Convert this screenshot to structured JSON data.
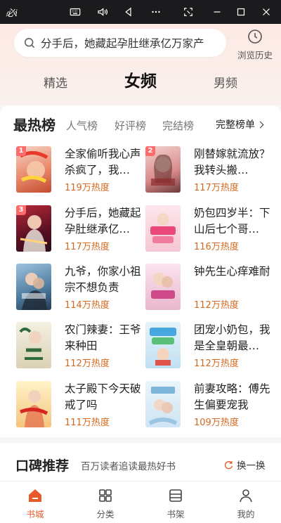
{
  "window": {
    "title": "必i"
  },
  "header": {
    "search": {
      "text": "分手后，她藏起孕肚继承亿万家产"
    },
    "history_label": "浏览历史",
    "tabs": [
      {
        "label": "精选"
      },
      {
        "label": "女频"
      },
      {
        "label": "男频"
      }
    ]
  },
  "ranking": {
    "tabs": [
      {
        "label": "最热榜"
      },
      {
        "label": "人气榜"
      },
      {
        "label": "好评榜"
      },
      {
        "label": "完结榜"
      }
    ],
    "full_list_label": "完整榜单",
    "books": [
      {
        "rank": "1",
        "title": "全家偷听我心声杀疯了，我…",
        "heat": "119万热度"
      },
      {
        "rank": "2",
        "title": "刚替嫁就流放？我转头搬…",
        "heat": "117万热度"
      },
      {
        "rank": "3",
        "title": "分手后，她藏起孕肚继承亿…",
        "heat": "117万热度"
      },
      {
        "rank": "",
        "title": "奶包四岁半：下山后七个哥…",
        "heat": "116万热度"
      },
      {
        "rank": "",
        "title": "九爷，你家小祖宗不想负责",
        "heat": "114万热度"
      },
      {
        "rank": "",
        "title": "钟先生心痒难耐",
        "heat": "112万热度"
      },
      {
        "rank": "",
        "title": "农门辣妻：王爷来种田",
        "heat": "112万热度"
      },
      {
        "rank": "",
        "title": "团宠小奶包，我是全皇朝最…",
        "heat": "112万热度"
      },
      {
        "rank": "",
        "title": "太子殿下今天破戒了吗",
        "heat": "111万热度"
      },
      {
        "rank": "",
        "title": "前妻攻略：傅先生偏要宠我",
        "heat": "109万热度"
      }
    ]
  },
  "recommend": {
    "title": "口碑推荐",
    "subtitle": "百万读者追读最热好书",
    "swap_label": "换一换"
  },
  "nav": {
    "items": [
      {
        "label": "书城"
      },
      {
        "label": "分类"
      },
      {
        "label": "书架"
      },
      {
        "label": "我的"
      }
    ]
  },
  "colors": {
    "accent": "#e85a2b",
    "heat": "#d2691e"
  }
}
